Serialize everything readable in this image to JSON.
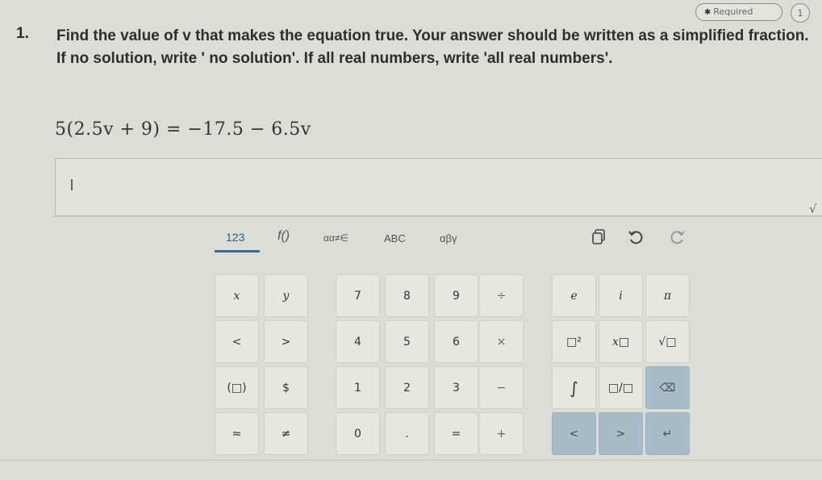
{
  "header": {
    "required_label": "Required",
    "question_count": "1"
  },
  "question": {
    "number": "1.",
    "text": "Find the value of v that makes the equation true. Your answer should be written as a simplified fraction. If no solution, write ' no solution'. If all real numbers, write 'all real numbers'.",
    "equation": "5(2.5v + 9) = −17.5 − 6.5v"
  },
  "answer": {
    "value": ""
  },
  "keyboard": {
    "tabs": [
      "123",
      "f()",
      "αα≠∈",
      "ABC",
      "αβγ"
    ],
    "active_tab": "123",
    "tools": {
      "copy": "copy-icon",
      "undo": "undo-icon",
      "redo": "redo-icon"
    },
    "rows": [
      [
        "x",
        "y",
        "7",
        "8",
        "9",
        "÷",
        "e",
        "i",
        "π"
      ],
      [
        "<",
        ">",
        "4",
        "5",
        "6",
        "×",
        "□²",
        "x□",
        "√□"
      ],
      [
        "(□)",
        "$",
        "1",
        "2",
        "3",
        "−",
        "∫",
        "□/□",
        "⌫"
      ],
      [
        "≈",
        "≠",
        "0",
        ".",
        "=",
        "+",
        "<",
        ">",
        "↵"
      ]
    ]
  },
  "colors": {
    "accent": "#3b6a98",
    "blue_key": "#a7bbc9",
    "background": "#dcddd6"
  }
}
